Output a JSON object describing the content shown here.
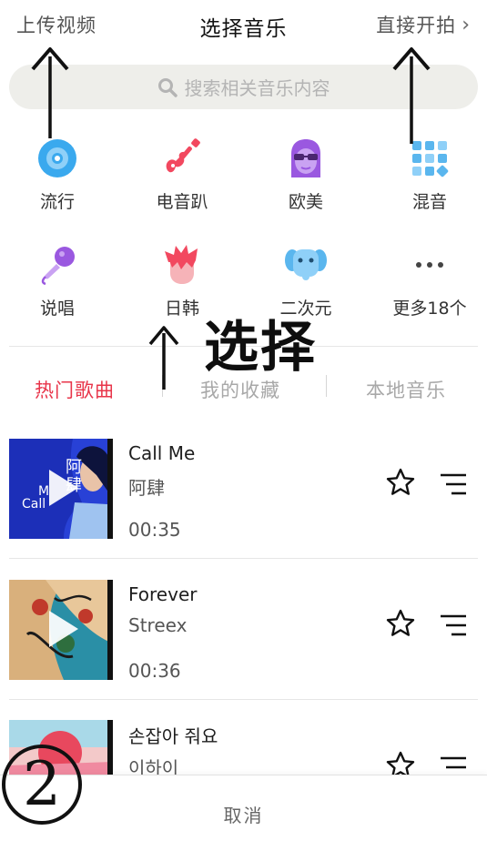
{
  "header": {
    "upload_label": "上传视频",
    "title": "选择音乐",
    "shoot_label": "直接开拍",
    "chevron_icon": "chevron-right-icon"
  },
  "search": {
    "placeholder": "搜索相关音乐内容",
    "icon": "search-icon"
  },
  "categories": [
    {
      "label": "流行",
      "icon": "vinyl-disc-icon",
      "color": "#3aa9ee"
    },
    {
      "label": "电音趴",
      "icon": "electric-guitar-icon",
      "color": "#f2485f"
    },
    {
      "label": "欧美",
      "icon": "sunglasses-face-icon",
      "color": "#9a58e0"
    },
    {
      "label": "混音",
      "icon": "grid-dots-icon",
      "color": "#5ab6ee"
    },
    {
      "label": "说唱",
      "icon": "microphone-icon",
      "color": "#9a58e0"
    },
    {
      "label": "日韩",
      "icon": "anime-hair-face-icon",
      "color": "#f2485f"
    },
    {
      "label": "二次元",
      "icon": "elephant-icon",
      "color": "#5ab6ee"
    },
    {
      "label": "更多18个",
      "icon": "more-dots-icon",
      "color": "#444444"
    }
  ],
  "tabs": [
    {
      "label": "热门歌曲",
      "active": true
    },
    {
      "label": "我的收藏",
      "active": false
    },
    {
      "label": "本地音乐",
      "active": false
    }
  ],
  "songs": [
    {
      "title": "Call Me",
      "artist": "阿肆",
      "duration": "00:35",
      "cover_text": "阿肆"
    },
    {
      "title": "Forever",
      "artist": "Streex",
      "duration": "00:36"
    },
    {
      "title": "손잡아 줘요",
      "artist": "이하이",
      "duration": ""
    }
  ],
  "footer": {
    "cancel_label": "取消"
  },
  "annotations": {
    "select_text": "选择",
    "step_number": "2"
  },
  "colors": {
    "accent": "#e8354a",
    "search_bg": "#eeeeea"
  }
}
